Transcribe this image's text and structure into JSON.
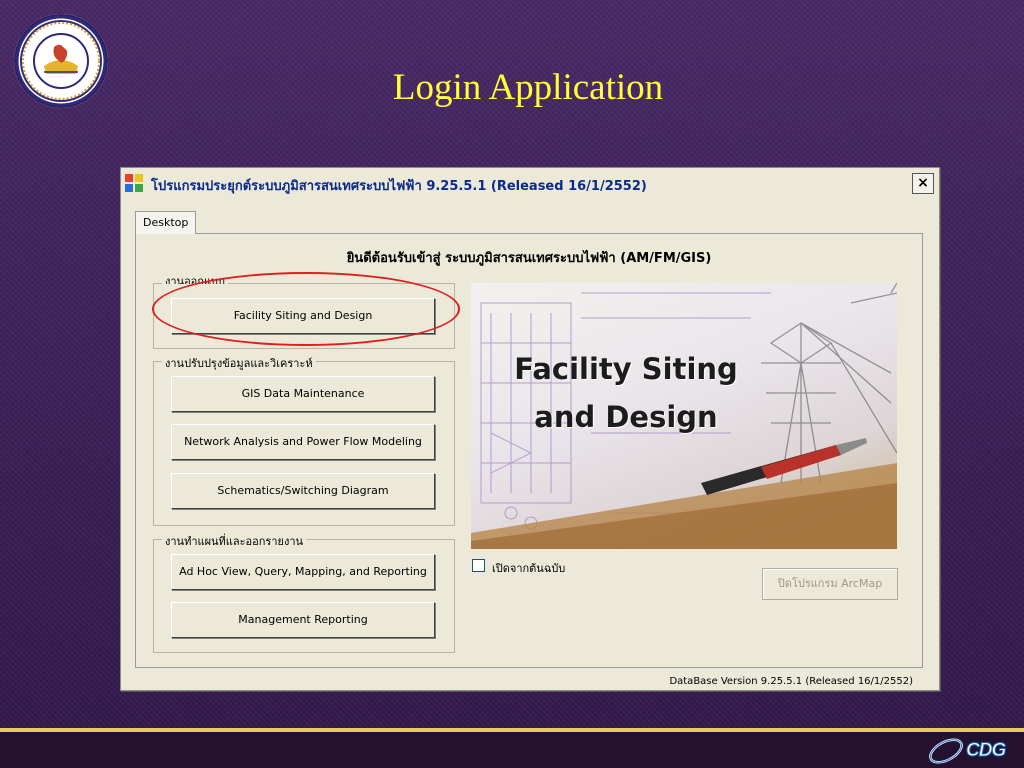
{
  "slide": {
    "title": "Login Application",
    "footer_brand": "CDG"
  },
  "window": {
    "title": "โปรแกรมประยุกต์ระบบภูมิสารสนเทศระบบไฟฟ้า 9.25.5.1 (Released 16/1/2552)",
    "close_label": "×",
    "tab_label": "Desktop",
    "welcome_text": "ยินดีต้อนรับเข้าสู่ ระบบภูมิสารสนเทศระบบไฟฟ้า (AM/FM/GIS)",
    "groups": {
      "design": {
        "legend": "งานออกแบบ",
        "buttons": [
          "Facility Siting and Design"
        ]
      },
      "maintenance": {
        "legend": "งานปรับปรุงข้อมูลและวิเคราะห์",
        "buttons": [
          "GIS Data Maintenance",
          "Network Analysis and Power Flow Modeling",
          "Schematics/Switching Diagram"
        ]
      },
      "reporting": {
        "legend": "งานทำแผนที่และออกรายงาน",
        "buttons": [
          "Ad Hoc View, Query, Mapping, and Reporting",
          "Management Reporting"
        ]
      }
    },
    "picture_caption_line1": "Facility Siting",
    "picture_caption_line2": "and Design",
    "checkbox_label": "เปิดจากต้นฉบับ",
    "arcmap_button": "ปิดโปรแกรม ArcMap",
    "db_version": "DataBase Version 9.25.5.1 (Released 16/1/2552)"
  },
  "colors": {
    "slide_title": "#ffff33",
    "highlight_ring": "#e01e1e",
    "window_title_text": "#0a2a8c"
  }
}
